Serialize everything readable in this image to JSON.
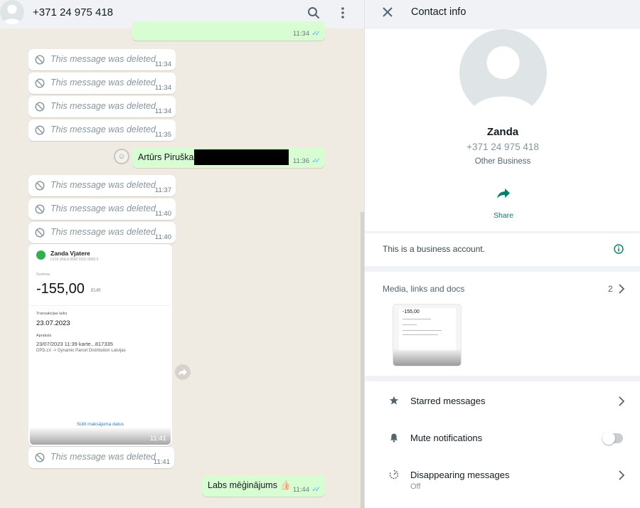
{
  "chat": {
    "header": {
      "title": "+371 24 975 418",
      "search_icon": "search-icon",
      "menu_icon": "menu-icon"
    },
    "messages": [
      {
        "time": "11:34"
      },
      {
        "text": "This message was deleted",
        "time": "11:34"
      },
      {
        "text": "This message was deleted",
        "time": "11:34"
      },
      {
        "text": "This message was deleted",
        "time": "11:34"
      },
      {
        "text": "This message was deleted",
        "time": "11:35"
      },
      {
        "text": "Artūrs Piruška,",
        "time": "11:36"
      },
      {
        "text": "This message was deleted",
        "time": "11:37"
      },
      {
        "text": "This message was deleted",
        "time": "11:40"
      },
      {
        "text": "This message was deleted",
        "time": "11:40"
      },
      {
        "time": "11:41"
      },
      {
        "text": "This message was deleted",
        "time": "11:41"
      },
      {
        "text": "Labs mēģinājums 👍🏻",
        "time": "11:44"
      }
    ],
    "receipt": {
      "name": "Zanda Vjatere",
      "iban": "LV19 UNLA 0050 0231 0663 5",
      "sum_label": "Summa",
      "amount": "-155,00",
      "currency": "EUR",
      "tx_date_label": "Transakcijas laiks",
      "tx_date": "23.07.2023",
      "desc_label": "Apraksts",
      "desc_line1": "23/07/2023 11:39    karte...817335",
      "desc_line2": "DPD.LV  ->  Dynamic Parcel Distribution Latvijas",
      "link": "Sūtīt maksājuma datus"
    }
  },
  "contact_info": {
    "title": "Contact info",
    "name": "Zanda",
    "phone": "+371 24 975 418",
    "type": "Other Business",
    "share_label": "Share",
    "business_note": "This is a business account.",
    "media_label": "Media, links and docs",
    "media_count": "2",
    "media_thumb_amount": "-155,00",
    "starred": "Starred messages",
    "mute": "Mute notifications",
    "mute_on": false,
    "disappearing": "Disappearing messages",
    "disappearing_value": "Off"
  },
  "colors": {
    "accent": "#008069",
    "outgoing_bubble": "#d9fdd3",
    "read_ticks": "#53bdeb",
    "chat_bg": "#efeae2"
  }
}
